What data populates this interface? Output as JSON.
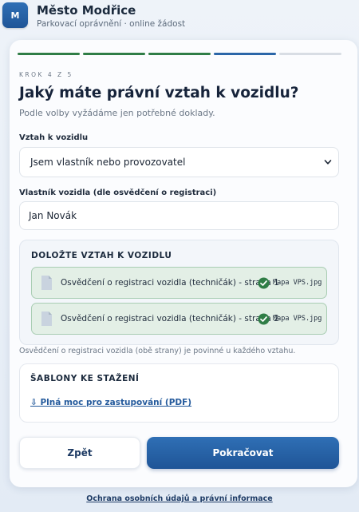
{
  "header": {
    "logo_letter": "M",
    "title": "Město Modřice",
    "subtitle": "Parkovací oprávnění · online žádost"
  },
  "progress": {
    "current_step": 4,
    "total_steps": 5,
    "completed_steps": 3,
    "step_label": "KROK 4 Z 5"
  },
  "page": {
    "title": "Jaký máte právní vztah k vozidlu?",
    "subtitle": "Podle volby vyžádáme jen potřebné doklady."
  },
  "relation_field": {
    "label": "Vztah k vozidlu",
    "value": "Jsem vlastník nebo provozovatel"
  },
  "owner_field": {
    "label": "Vlastník vozidla (dle osvědčení o registraci)",
    "value": "Jan Novák"
  },
  "documents": {
    "title": "DOLOŽTE VZTAH K VOZIDLU",
    "items": [
      {
        "name": "Osvědčení o registraci vozidla (techničák) - strana 1",
        "file": "Mapa VPS.jpg",
        "status": "uploaded"
      },
      {
        "name": "Osvědčení o registraci vozidla (techničák) - strana 2",
        "file": "Mapa VPS.jpg",
        "status": "uploaded"
      }
    ],
    "note": "Osvědčení o registraci vozidla (obě strany) je povinné u každého vztahu."
  },
  "templates": {
    "title": "ŠABLONY KE STAŽENÍ",
    "link_label": "⇩ Plná moc pro zastupování (PDF)"
  },
  "actions": {
    "back_label": "Zpět",
    "next_label": "Pokračovat"
  },
  "footer": {
    "link_label": "Ochrana osobních údajů a právní informace"
  },
  "colors": {
    "accent": "#2b66a8",
    "success": "#2f7d46",
    "upload_bg": "#e3efe6"
  },
  "icons": {
    "document": "document-icon",
    "check": "check-circle-icon",
    "select_arrow": "chevron-down-icon"
  }
}
